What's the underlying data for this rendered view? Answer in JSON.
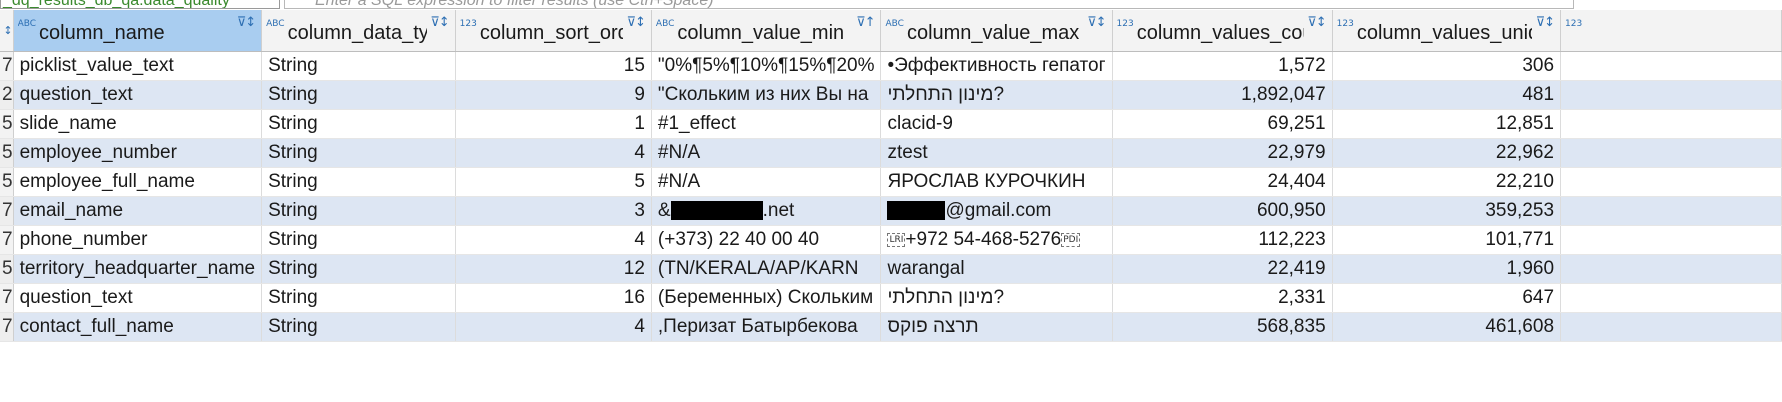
{
  "filter": {
    "source_label": "_dq_results_db_qa.data_quality",
    "placeholder": "Enter a SQL expression to filter results (use Ctrl+Space)"
  },
  "icons": {
    "string_type": "ABC",
    "number_type": "123",
    "header_sort_filter": "filter-sort-icon"
  },
  "columns": [
    {
      "label": "column_name",
      "type_badge": "ABC",
      "align": "left"
    },
    {
      "label": "column_data_type",
      "type_badge": "ABC",
      "align": "left"
    },
    {
      "label": "column_sort_order",
      "type_badge": "123",
      "align": "right"
    },
    {
      "label": "column_value_min",
      "type_badge": "ABC",
      "align": "left"
    },
    {
      "label": "column_value_max",
      "type_badge": "ABC",
      "align": "left"
    },
    {
      "label": "column_values_count",
      "type_badge": "123",
      "align": "right"
    },
    {
      "label": "column_values_unique",
      "type_badge": "123",
      "align": "right"
    },
    {
      "label": "",
      "type_badge": "123",
      "align": "right"
    }
  ],
  "rows": [
    {
      "rownum": "7",
      "cells": [
        "picklist_value_text",
        "String",
        "15",
        "\"0%¶5%¶10%¶15%¶20%",
        "•Эффективность гепатог",
        "1,572",
        "306",
        ""
      ]
    },
    {
      "rownum": "2",
      "cells": [
        "question_text",
        "String",
        "9",
        "\"Скольким из них Вы на",
        "מינון התחלתי?",
        "1,892,047",
        "481",
        ""
      ]
    },
    {
      "rownum": "5",
      "cells": [
        "slide_name",
        "String",
        "1",
        "#1_effect",
        "clacid-9",
        "69,251",
        "12,851",
        ""
      ]
    },
    {
      "rownum": "5",
      "cells": [
        "employee_number",
        "String",
        "4",
        "#N/A",
        "ztest",
        "22,979",
        "22,962",
        ""
      ]
    },
    {
      "rownum": "5",
      "cells": [
        "employee_full_name",
        "String",
        "5",
        "#N/A",
        "ЯРОСЛАВ КУРОЧКИН",
        "24,404",
        "22,210",
        ""
      ]
    },
    {
      "rownum": "7",
      "cells": [
        "email_name",
        "String",
        "3",
        "&.net",
        "@gmail.com",
        "600,950",
        "359,253",
        ""
      ]
    },
    {
      "rownum": "7",
      "cells": [
        "phone_number",
        "String",
        "4",
        "(+373) 22 40 00 40",
        "+972 54-468-5276",
        "112,223",
        "101,771",
        ""
      ]
    },
    {
      "rownum": "5",
      "cells": [
        "territory_headquarter_name",
        "String",
        "12",
        "(TN/KERALA/AP/KARN",
        "warangal",
        "22,419",
        "1,960",
        ""
      ]
    },
    {
      "rownum": "7",
      "cells": [
        "question_text",
        "String",
        "16",
        "(Беременных) Скольким",
        "מינון התחלתי?",
        "2,331",
        "647",
        ""
      ]
    },
    {
      "rownum": "7",
      "cells": [
        "contact_full_name",
        "String",
        "4",
        ",Перизат Батырбекова",
        "תרצה פוקס",
        "568,835",
        "461,608",
        ""
      ]
    }
  ],
  "control_marks": {
    "lri": "LRI",
    "pdi": "PDI"
  },
  "colors": {
    "selected_header": "#a9cdf0",
    "alt_row": "#dde6f3",
    "type_badge": "#2d6fb3",
    "filter_source_text": "#3a8a2e"
  }
}
